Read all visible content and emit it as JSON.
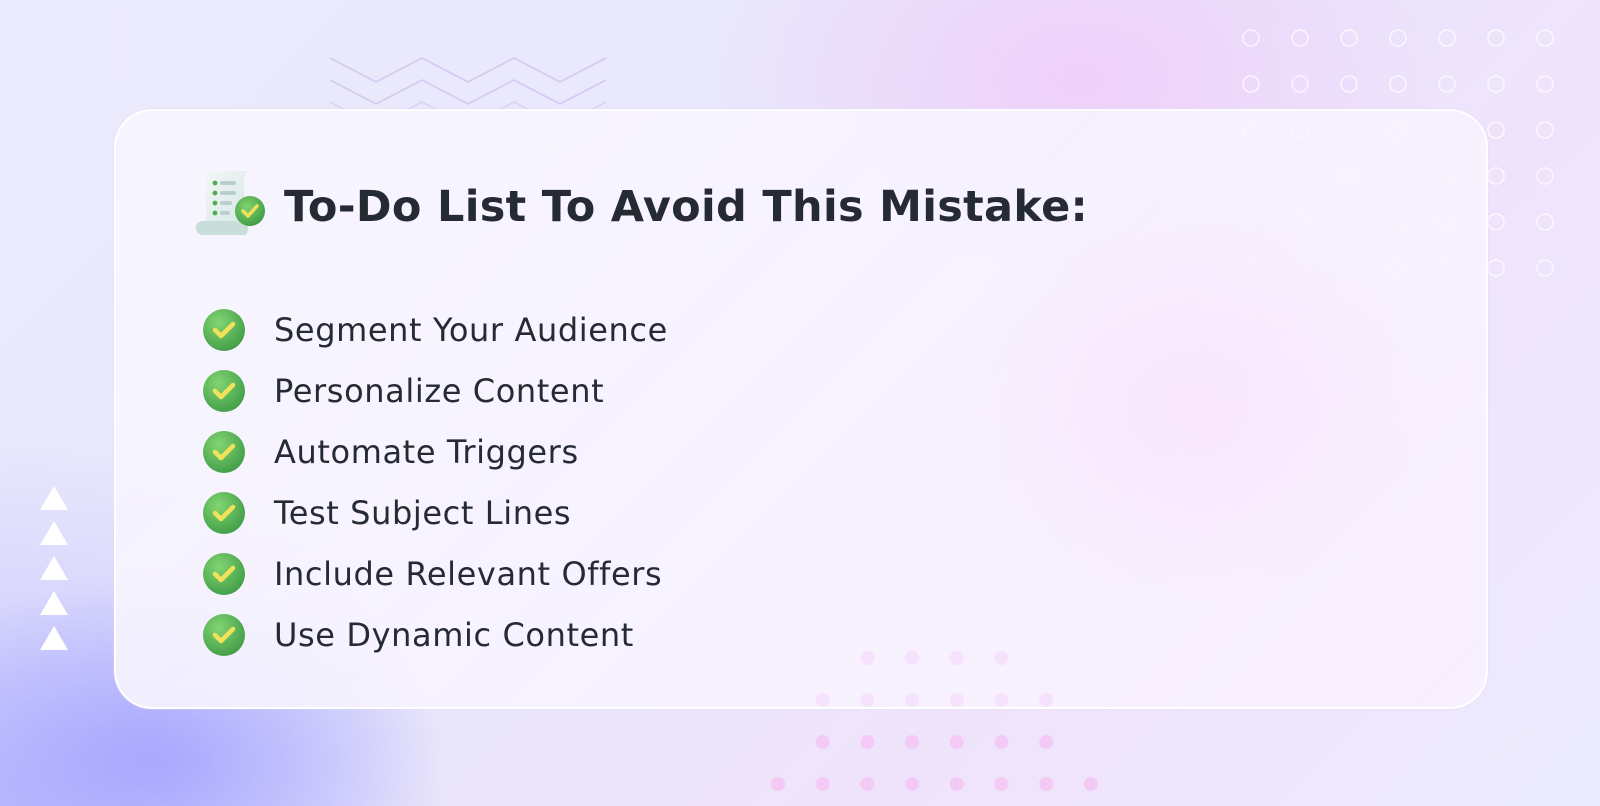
{
  "title": "To-Do List To Avoid This Mistake:",
  "title_icon": "checklist-scroll-icon",
  "items": [
    {
      "label": "Segment Your Audience",
      "icon": "check-circle-icon"
    },
    {
      "label": "Personalize Content",
      "icon": "check-circle-icon"
    },
    {
      "label": "Automate Triggers",
      "icon": "check-circle-icon"
    },
    {
      "label": "Test Subject Lines",
      "icon": "check-circle-icon"
    },
    {
      "label": "Include Relevant Offers",
      "icon": "check-circle-icon"
    },
    {
      "label": "Use Dynamic Content",
      "icon": "check-circle-icon"
    }
  ],
  "colors": {
    "text": "#262b33",
    "check_green": "#4caf50",
    "check_mark": "#f2e25a",
    "accent_purple": "#a9a6fb",
    "accent_pink": "#f3c6f5"
  }
}
